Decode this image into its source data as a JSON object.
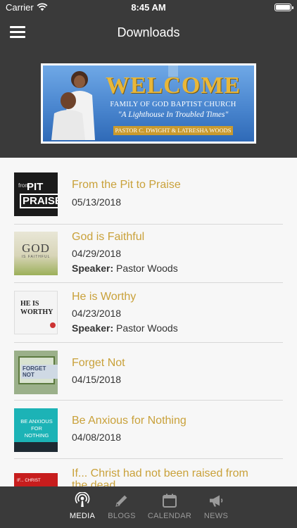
{
  "status_bar": {
    "carrier": "Carrier",
    "time": "8:45 AM"
  },
  "nav": {
    "title": "Downloads",
    "menu_icon": "hamburger-menu-icon"
  },
  "banner": {
    "welcome": "WELCOME",
    "church": "FAMILY OF GOD BAPTIST CHURCH",
    "tagline": "\"A Lighthouse In Troubled Times\"",
    "pastor": "PASTOR C. DWIGHT & LATRESHA WOODS"
  },
  "media_list": [
    {
      "title": "From the Pit to Praise",
      "date": "05/13/2018",
      "thumb_text": [
        "from",
        "PIT",
        "PRAISE"
      ]
    },
    {
      "title": "God is Faithful",
      "date": "04/29/2018",
      "speaker_label": "Speaker:",
      "speaker": "Pastor Woods",
      "thumb_text": [
        "GOD",
        "IS FAITHFUL"
      ]
    },
    {
      "title": "He is Worthy",
      "date": "04/23/2018",
      "speaker_label": "Speaker:",
      "speaker": "Pastor Woods",
      "thumb_text": [
        "HE IS",
        "WORTHY"
      ]
    },
    {
      "title": "Forget Not",
      "date": "04/15/2018",
      "thumb_text": [
        "FORGET NOT"
      ]
    },
    {
      "title": "Be Anxious for Nothing",
      "date": "04/08/2018",
      "thumb_text": [
        "BE ANXIOUS",
        "FOR",
        "NOTHING"
      ]
    },
    {
      "title": "If... Christ had not been raised from the dead",
      "thumb_text": [
        "IF... CHRIST"
      ]
    }
  ],
  "tabs": [
    {
      "label": "MEDIA",
      "icon": "podcast-icon",
      "active": true
    },
    {
      "label": "BLOGS",
      "icon": "pencil-icon",
      "active": false
    },
    {
      "label": "CALENDAR",
      "icon": "calendar-icon",
      "active": false
    },
    {
      "label": "NEWS",
      "icon": "megaphone-icon",
      "active": false
    }
  ],
  "colors": {
    "bar": "#3a3a3a",
    "title_gold": "#c9a13a",
    "list_bg": "#f7f7f7"
  }
}
